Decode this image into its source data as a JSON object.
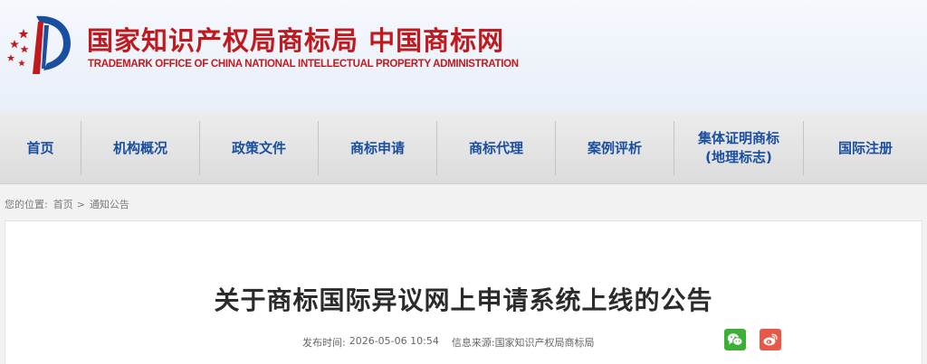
{
  "header": {
    "title": "国家知识产权局商标局  中国商标网",
    "subtitle": "TRADEMARK OFFICE OF CHINA NATIONAL INTELLECTUAL PROPERTY ADMINISTRATION",
    "emblem_icon": "stars-and-column-emblem-icon",
    "brand_color": "#c01a1f"
  },
  "nav": {
    "color": "#1a4fa0",
    "items": [
      {
        "label": "首页"
      },
      {
        "label": "机构概况"
      },
      {
        "label": "政策文件"
      },
      {
        "label": "商标申请"
      },
      {
        "label": "商标代理"
      },
      {
        "label": "案例评析"
      },
      {
        "label": "集体证明商标\n(地理标志)"
      },
      {
        "label": "国际注册"
      }
    ]
  },
  "breadcrumb": {
    "prefix": "您的位置:",
    "home": "首页",
    "separator": ">",
    "current": "通知公告"
  },
  "article": {
    "title": "关于商标国际异议网上申请系统上线的公告",
    "publish_label": "发布时间:",
    "publish_time": "2026-05-06 10:54",
    "source_label": "信息来源:",
    "source": "国家知识产权局商标局"
  },
  "share": {
    "wechat_icon": "wechat-icon",
    "weibo_icon": "weibo-icon",
    "wechat_color": "#3cb035",
    "weibo_color": "#e85848"
  }
}
